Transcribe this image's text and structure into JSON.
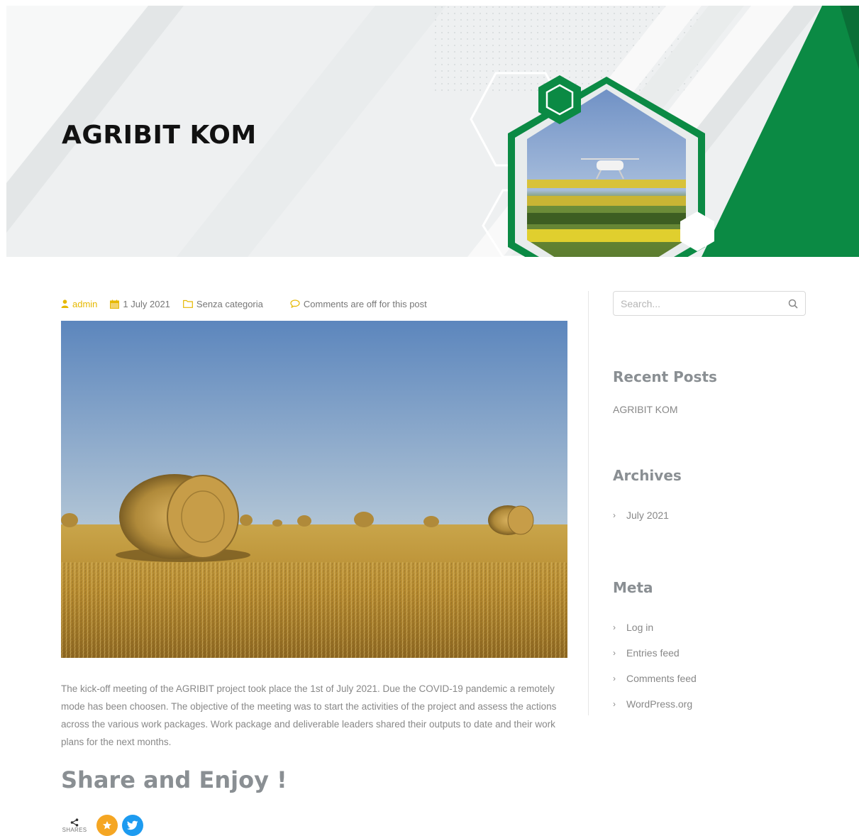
{
  "hero": {
    "title": "AGRIBIT KOM",
    "accent_color": "#0b8a44",
    "dark_accent_color": "#0a6f37"
  },
  "post_meta": {
    "author": "admin",
    "date": "1 July 2021",
    "category": "Senza categoria",
    "comments": "Comments are off for this post",
    "author_color": "#e6b800"
  },
  "post": {
    "body": "The kick-off meeting of the AGRIBIT project took place the 1st of July 2021. Due the COVID-19 pandemic a remotely mode has been choosen. The objective of the meeting was to start the activities of the project and assess the actions across the various work packages. Work package and deliverable leaders shared their outputs to date and their work plans for the next months.",
    "share_title": "Share and Enjoy !",
    "share_count_label": "SHARES"
  },
  "sidebar": {
    "search": {
      "placeholder": "Search..."
    },
    "recent_posts": {
      "title": "Recent Posts",
      "items": [
        "AGRIBIT KOM"
      ]
    },
    "archives": {
      "title": "Archives",
      "items": [
        "July 2021"
      ]
    },
    "meta": {
      "title": "Meta",
      "items": [
        "Log in",
        "Entries feed",
        "Comments feed",
        "WordPress.org"
      ]
    }
  },
  "icons": {
    "author": "user-icon",
    "date": "calendar-icon",
    "category": "folder-icon",
    "comments": "comment-icon",
    "search": "search-icon",
    "share": "share-icon",
    "favorite": "star-icon",
    "twitter": "twitter-icon"
  }
}
